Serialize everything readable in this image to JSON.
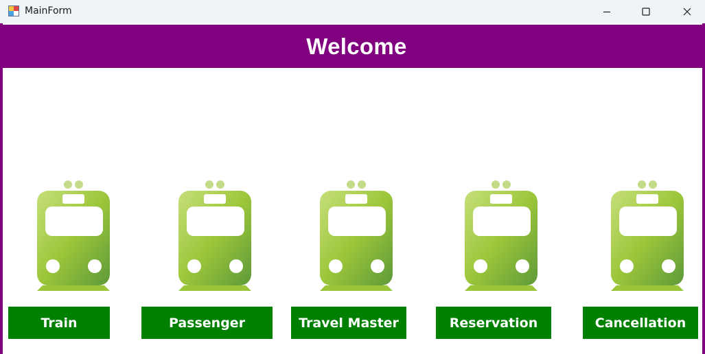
{
  "window": {
    "title": "MainForm",
    "controls": [
      "minimize-icon",
      "maximize-icon",
      "close-icon"
    ]
  },
  "header": {
    "title": "Welcome",
    "background": "#800080"
  },
  "buttons": [
    {
      "label": "Train",
      "icon": "train-icon"
    },
    {
      "label": "Passenger",
      "icon": "train-icon"
    },
    {
      "label": "Travel Master",
      "icon": "train-icon"
    },
    {
      "label": "Reservation",
      "icon": "train-icon"
    },
    {
      "label": "Cancellation",
      "icon": "train-icon"
    }
  ],
  "colors": {
    "accent": "#800080",
    "button": "#008000",
    "icon": "#8dc63f"
  }
}
